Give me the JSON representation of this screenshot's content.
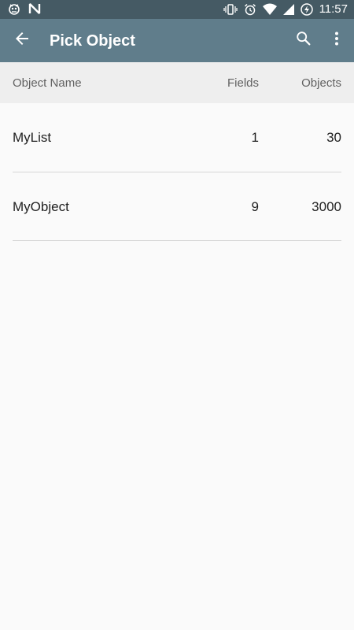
{
  "status_bar": {
    "time": "11:57",
    "icons": [
      "notification-app-icon",
      "notification-n-icon",
      "vibrate-icon",
      "alarm-icon",
      "wifi-icon",
      "signal-icon",
      "battery-charging-icon"
    ]
  },
  "app_bar": {
    "title": "Pick Object",
    "icons": [
      "back-arrow-icon",
      "search-icon",
      "more-vert-icon"
    ]
  },
  "table": {
    "headers": {
      "name": "Object Name",
      "fields": "Fields",
      "objects": "Objects"
    },
    "rows": [
      {
        "name": "MyList",
        "fields": "1",
        "objects": "30"
      },
      {
        "name": "MyObject",
        "fields": "9",
        "objects": "3000"
      }
    ]
  },
  "colors": {
    "status_bar": "#455a64",
    "app_bar": "#607d8b",
    "header_bg": "#eeeeee",
    "background": "#fafafa"
  }
}
